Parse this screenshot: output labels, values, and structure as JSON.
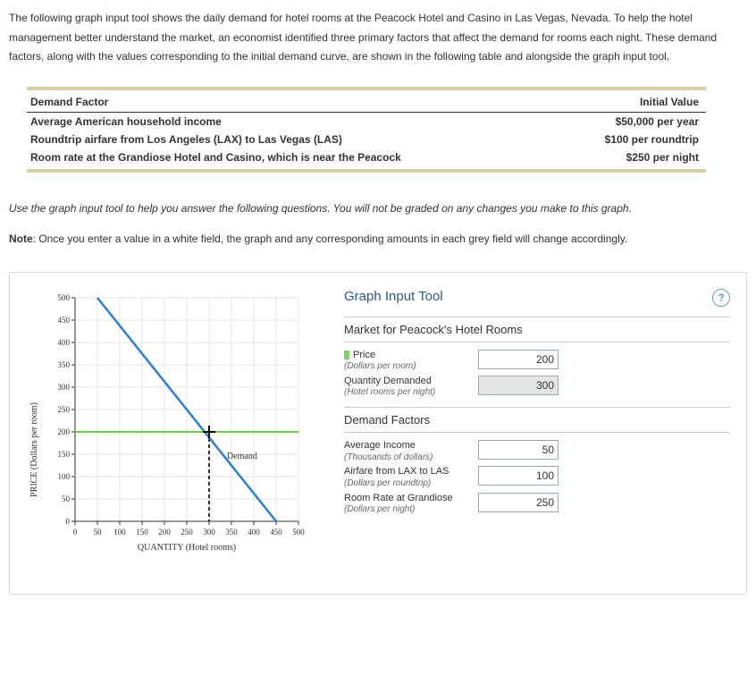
{
  "intro": "The following graph input tool shows the daily demand for hotel rooms at the Peacock Hotel and Casino in Las Vegas, Nevada. To help the hotel management better understand the market, an economist identified three primary factors that affect the demand for rooms each night. These demand factors, along with the values corresponding to the initial demand curve, are shown in the following table and alongside the graph input tool.",
  "table": {
    "head_factor": "Demand Factor",
    "head_value": "Initial Value",
    "rows": [
      {
        "factor": "Average American household income",
        "value": "$50,000 per year"
      },
      {
        "factor": "Roundtrip airfare from Los Angeles (LAX) to Las Vegas (LAS)",
        "value": "$100 per roundtrip"
      },
      {
        "factor": "Room rate at the Grandiose Hotel and Casino, which is near the Peacock",
        "value": "$250 per night"
      }
    ]
  },
  "instructions": "Use the graph input tool to help you answer the following questions. You will not be graded on any changes you make to this graph.",
  "note_label": "Note",
  "note_body": ": Once you enter a value in a white field, the graph and any corresponding amounts in each grey field will change accordingly.",
  "tool": {
    "title": "Graph Input Tool",
    "subtitle": "Market for Peacock's Hotel Rooms",
    "price_label": "Price",
    "price_sub": "(Dollars per room)",
    "price_value": "200",
    "qty_label": "Quantity Demanded",
    "qty_sub": "(Hotel rooms per night)",
    "qty_value": "300",
    "factors_head": "Demand Factors",
    "income_label": "Average Income",
    "income_sub": "(Thousands of dollars)",
    "income_value": "50",
    "airfare_label": "Airfare from LAX to LAS",
    "airfare_sub": "(Dollars per roundtrip)",
    "airfare_value": "100",
    "rate_label": "Room Rate at Grandiose",
    "rate_sub": "(Dollars per night)",
    "rate_value": "250",
    "help": "?"
  },
  "chart_data": {
    "type": "line",
    "title": "",
    "xlabel": "QUANTITY (Hotel rooms)",
    "ylabel": "PRICE (Dollars per room)",
    "xlim": [
      0,
      500
    ],
    "ylim": [
      0,
      500
    ],
    "xticks": [
      0,
      50,
      100,
      150,
      200,
      250,
      300,
      350,
      400,
      450,
      500
    ],
    "yticks": [
      0,
      50,
      100,
      150,
      200,
      250,
      300,
      350,
      400,
      450,
      500
    ],
    "series": [
      {
        "name": "Demand",
        "x": [
          50,
          450
        ],
        "y": [
          500,
          0
        ],
        "color": "#2a7fd4"
      }
    ],
    "hline": {
      "y": 200,
      "color": "#6fcf4f"
    },
    "point": {
      "x": 300,
      "y": 200
    },
    "legend": "Demand"
  }
}
